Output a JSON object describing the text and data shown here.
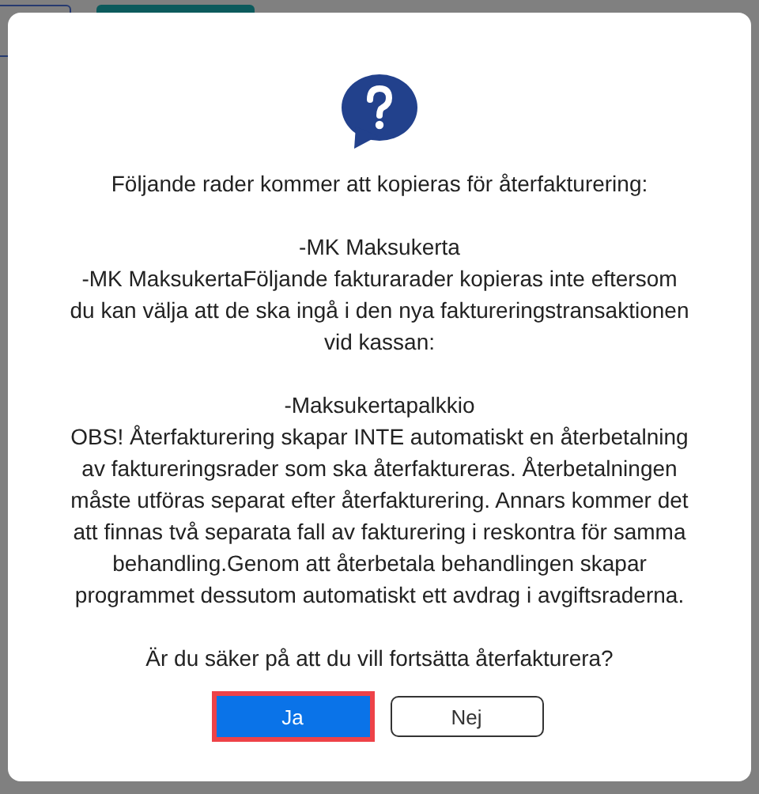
{
  "dialog": {
    "paragraphs": [
      "Följande rader kommer att kopieras för återfakturering:",
      "-MK Maksukerta\n-MK MaksukertaFöljande fakturarader kopieras inte eftersom du kan välja att de ska ingå i den nya faktureringstransaktionen vid kassan:",
      "-Maksukertapalkkio\nOBS! Återfakturering skapar INTE automatiskt en återbetalning av faktureringsrader som ska återfaktureras. Återbetalningen måste utföras separat efter återfakturering. Annars kommer det att finnas två separata fall av fakturering i reskontra för samma behandling.Genom att återbetala behandlingen skapar programmet dessutom automatiskt ett avdrag i avgiftsraderna.",
      "Är du säker på att du vill fortsätta återfakturera?"
    ],
    "buttons": [
      {
        "label": "Ja",
        "kind": "primary",
        "focused": true
      },
      {
        "label": "Nej",
        "kind": "secondary",
        "focused": false
      }
    ]
  }
}
